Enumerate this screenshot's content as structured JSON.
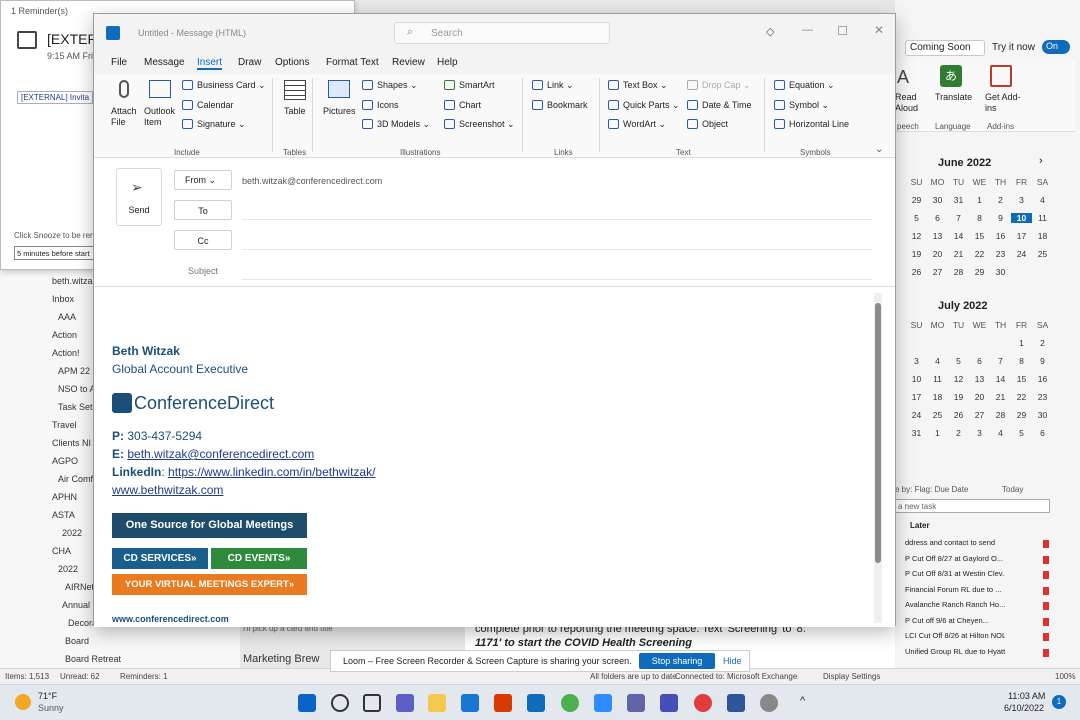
{
  "reminder": {
    "title": "1 Reminder(s)",
    "item": "[EXTERN",
    "time": "9:15 AM Fri",
    "list_item": "[EXTERNAL] Invita",
    "snooze_hint": "Click Snooze to be rem",
    "snooze_value": "5 minutes before start"
  },
  "folders": [
    "beth.witza",
    "Inbox",
    "AAA",
    "Action",
    "Action!",
    "APM 22",
    "NSO to A",
    "Task Set",
    "Travel",
    "Clients NI",
    "AGPO",
    "Air Comf",
    "APHN",
    "ASTA",
    "2022",
    "CHA",
    "2022",
    "AIRNet",
    "Annual",
    "Decorat",
    "Board",
    "Board Retreat"
  ],
  "window": {
    "title": "Untitled  -  Message (HTML)",
    "search_placeholder": "Search"
  },
  "menu": [
    "File",
    "Message",
    "Insert",
    "Draw",
    "Options",
    "Format Text",
    "Review",
    "Help"
  ],
  "ribbon": {
    "attach": "Attach File",
    "outlook_item": "Outlook Item",
    "business_card": "Business Card",
    "calendar": "Calendar",
    "signature": "Signature",
    "include": "Include",
    "table": "Table",
    "tables": "Tables",
    "pictures": "Pictures",
    "shapes": "Shapes",
    "icons": "Icons",
    "models": "3D Models",
    "smartart": "SmartArt",
    "chart": "Chart",
    "screenshot": "Screenshot",
    "illustrations": "Illustrations",
    "link": "Link",
    "bookmark": "Bookmark",
    "links": "Links",
    "textbox": "Text Box",
    "quickparts": "Quick Parts",
    "wordart": "WordArt",
    "dropcap": "Drop Cap",
    "datetime": "Date & Time",
    "object": "Object",
    "text": "Text",
    "equation": "Equation",
    "symbol": "Symbol",
    "hline": "Horizontal Line",
    "symbols": "Symbols"
  },
  "compose": {
    "send": "Send",
    "from": "From",
    "from_value": "beth.witzak@conferencedirect.com",
    "to": "To",
    "cc": "Cc",
    "subject": "Subject"
  },
  "signature": {
    "name": "Beth Witzak",
    "title": "Global Account Executive",
    "logo": "ConferenceDirect",
    "phone_label": "P:",
    "phone": "303-437-5294",
    "email_label": "E:",
    "email": "beth.witzak@conferencedirect.com",
    "linkedin_label": "LinkedIn",
    "linkedin": "https://www.linkedin.com/in/bethwitzak/",
    "website": "www.bethwitzak.com",
    "banner1": "One Source for Global Meetings",
    "banner2": "CD SERVICES»",
    "banner3": "CD EVENTS»",
    "banner4": "YOUR VIRTUAL MEETINGS EXPERT»",
    "banner_url": "www.conferencedirect.com"
  },
  "right": {
    "coming_soon": "Coming Soon",
    "try_now": "Try it now",
    "toggle": "On",
    "read_aloud": "Read Aloud",
    "translate": "Translate",
    "get_addins": "Get Add-ins",
    "speech": "peech",
    "language": "Language",
    "addins": "Add-ins"
  },
  "june": {
    "title": "June 2022",
    "dow": [
      "SU",
      "MO",
      "TU",
      "WE",
      "TH",
      "FR",
      "SA"
    ],
    "days": [
      "29",
      "30",
      "31",
      "1",
      "2",
      "3",
      "4",
      "5",
      "6",
      "7",
      "8",
      "9",
      "10",
      "11",
      "12",
      "13",
      "14",
      "15",
      "16",
      "17",
      "18",
      "19",
      "20",
      "21",
      "22",
      "23",
      "24",
      "25",
      "26",
      "27",
      "28",
      "29",
      "30"
    ]
  },
  "july": {
    "title": "July 2022",
    "dow": [
      "SU",
      "MO",
      "TU",
      "WE",
      "TH",
      "FR",
      "SA"
    ],
    "days": [
      "1",
      "2",
      "3",
      "4",
      "5",
      "6",
      "7",
      "8",
      "9",
      "10",
      "11",
      "12",
      "13",
      "14",
      "15",
      "16",
      "17",
      "18",
      "19",
      "20",
      "21",
      "22",
      "23",
      "24",
      "25",
      "26",
      "27",
      "28",
      "29",
      "30",
      "31",
      "1",
      "2",
      "3",
      "4",
      "5",
      "6"
    ]
  },
  "tasks": {
    "arrange": "e by: Flag: Due Date",
    "today": "Today",
    "new_task": "a new task",
    "later": "Later",
    "items": [
      "ddress and contact to send",
      "P Cut Off 8/27 at Gaylord O...",
      "P Cut Off 8/31 at Westin Clev...",
      "Financial Forum RL due to ...",
      "Avalanche Ranch Ranch Ho...",
      "P Cut off 9/6 at Cheyen...",
      "LCI Cut Off 8/26 at Hilton NOLA",
      "Unified Group RL due to Hyatt Ho..."
    ]
  },
  "bottom_msg": {
    "line1": "complete prior to reporting the meeting space. Text 'Screening' to '8:",
    "line2": "1171' to start the COVID Health Screening",
    "pickup": "I'll pick up a card and title",
    "marketing": "Marketing Brew"
  },
  "share_bar": {
    "text": "Loom – Free Screen Recorder & Screen Capture is sharing your screen.",
    "stop": "Stop sharing",
    "hide": "Hide"
  },
  "status": {
    "items": "Items: 1,513",
    "unread": "Unread: 62",
    "reminders": "Reminders: 1",
    "updated": "All folders are up to date.",
    "connected": "Connected to: Microsoft Exchange",
    "display": "Display Settings",
    "zoom": "100%"
  },
  "taskbar": {
    "temp": "71°F",
    "weather": "Sunny",
    "time": "11:03 AM",
    "date": "6/10/2022",
    "badge": "1"
  }
}
